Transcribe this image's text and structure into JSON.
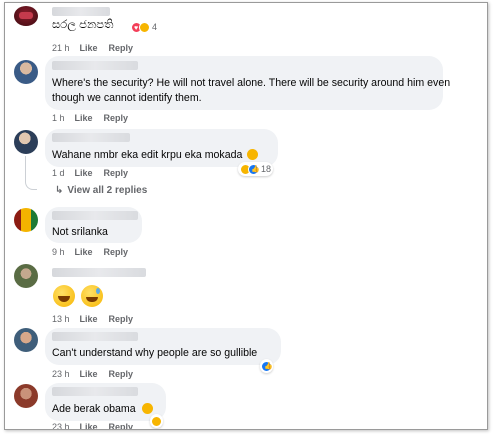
{
  "comments": [
    {
      "text": "සරල ජනපති",
      "time": "21 h",
      "like": "Like",
      "reply": "Reply",
      "reaction_count": "4"
    },
    {
      "text_line1": "Where's the security? He will not travel alone. There will be security around him even",
      "text_line2": "though we cannot identify them.",
      "time": "1 h",
      "like": "Like",
      "reply": "Reply"
    },
    {
      "text": "Wahane nmbr eka edit krpu eka mokada",
      "time": "1 d",
      "like": "Like",
      "reply": "Reply",
      "reaction_count": "18",
      "view_replies": "View all 2 replies"
    },
    {
      "text": "Not srilanka",
      "time": "9 h",
      "like": "Like",
      "reply": "Reply"
    },
    {
      "time": "13 h",
      "like": "Like",
      "reply": "Reply"
    },
    {
      "text": "Can't understand why people are so gullible",
      "time": "23 h",
      "like": "Like",
      "reply": "Reply"
    },
    {
      "text": "Ade berak obama",
      "time": "23 h",
      "like": "Like",
      "reply": "Reply"
    }
  ],
  "icons": {
    "reply_arrow": "reply-arrow-icon",
    "heart": "heart-reaction-icon",
    "haha": "haha-reaction-icon",
    "like": "like-reaction-icon"
  },
  "colors": {
    "bubble": "#f0f2f5",
    "meta_text": "#65676b",
    "like_blue": "#1877f2",
    "love_red": "#f33e58",
    "emoji_yellow": "#f7b500"
  }
}
